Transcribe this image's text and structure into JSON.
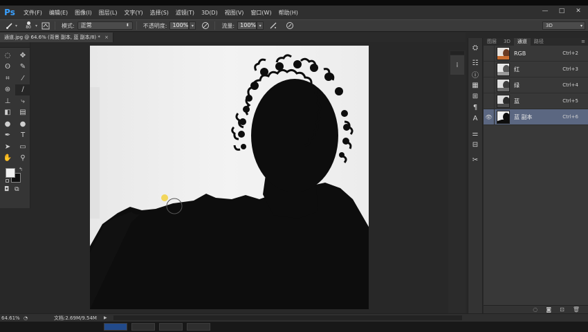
{
  "app": {
    "logo": "Ps",
    "window_controls": [
      "—",
      "□",
      "✕"
    ]
  },
  "menu": [
    "文件(F)",
    "编辑(E)",
    "图像(I)",
    "图层(L)",
    "文字(Y)",
    "选择(S)",
    "滤镜(T)",
    "3D(D)",
    "视图(V)",
    "窗口(W)",
    "帮助(H)"
  ],
  "options": {
    "brush_size": "80",
    "mode_label": "模式:",
    "mode_value": "正常",
    "opacity_label": "不透明度:",
    "opacity_value": "100%",
    "flow_label": "流量:",
    "flow_value": "100%",
    "workspace_value": "3D"
  },
  "document": {
    "tab_title": "通道.jpg @ 64.6% (背景 副本, 蓝 副本/8) *",
    "close": "×"
  },
  "tools": [
    {
      "name": "marquee-tool-icon",
      "glyph": "◌"
    },
    {
      "name": "move-tool-icon",
      "glyph": "✥"
    },
    {
      "name": "lasso-tool-icon",
      "glyph": "ʘ"
    },
    {
      "name": "quick-select-tool-icon",
      "glyph": "✎"
    },
    {
      "name": "crop-tool-icon",
      "glyph": "⌗"
    },
    {
      "name": "eyedropper-tool-icon",
      "glyph": "⁄"
    },
    {
      "name": "healing-brush-tool-icon",
      "glyph": "⊛"
    },
    {
      "name": "brush-tool-icon",
      "glyph": "∕"
    },
    {
      "name": "clone-stamp-tool-icon",
      "glyph": "⊥"
    },
    {
      "name": "history-brush-tool-icon",
      "glyph": "⤷"
    },
    {
      "name": "eraser-tool-icon",
      "glyph": "◧"
    },
    {
      "name": "gradient-tool-icon",
      "glyph": "▤"
    },
    {
      "name": "blur-tool-icon",
      "glyph": "●"
    },
    {
      "name": "dodge-tool-icon",
      "glyph": "●"
    },
    {
      "name": "pen-tool-icon",
      "glyph": "✒"
    },
    {
      "name": "type-tool-icon",
      "glyph": "T"
    },
    {
      "name": "path-select-tool-icon",
      "glyph": "➤"
    },
    {
      "name": "rectangle-tool-icon",
      "glyph": "▭"
    },
    {
      "name": "hand-tool-icon",
      "glyph": "✋"
    },
    {
      "name": "zoom-tool-icon",
      "glyph": "⚲"
    }
  ],
  "panel": {
    "tabs": [
      "图层",
      "3D",
      "通道",
      "路径"
    ],
    "active_tab": "通道",
    "channels": [
      {
        "name": "RGB",
        "shortcut": "Ctrl+2",
        "visible": false,
        "selected": false
      },
      {
        "name": "红",
        "shortcut": "Ctrl+3",
        "visible": false,
        "selected": false
      },
      {
        "name": "绿",
        "shortcut": "Ctrl+4",
        "visible": false,
        "selected": false
      },
      {
        "name": "蓝",
        "shortcut": "Ctrl+5",
        "visible": false,
        "selected": false
      },
      {
        "name": "蓝 副本",
        "shortcut": "Ctrl+6",
        "visible": true,
        "selected": true
      }
    ]
  },
  "status": {
    "zoom": "64.61%",
    "doc_size": "文档:2.69M/9.54M"
  },
  "colors": {
    "foreground": "#f2f2f2",
    "background": "#111111",
    "selected_channel": "#5b6781",
    "ps_logo": "#3aa0ff"
  }
}
